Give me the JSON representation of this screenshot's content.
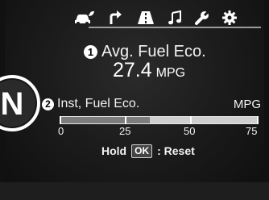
{
  "tabs": [
    {
      "name": "car-eco-tab",
      "icon": "car-leaf-icon",
      "active": true
    },
    {
      "name": "navigation-tab",
      "icon": "turn-arrow-icon"
    },
    {
      "name": "road-tab",
      "icon": "road-icon"
    },
    {
      "name": "music-tab",
      "icon": "music-note-icon"
    },
    {
      "name": "service-tab",
      "icon": "wrench-icon"
    },
    {
      "name": "settings-tab",
      "icon": "gear-icon"
    }
  ],
  "avg": {
    "index": "1",
    "label": "Avg. Fuel Eco.",
    "value": "27.4",
    "unit": "MPG"
  },
  "gear": {
    "letter": "N"
  },
  "inst": {
    "index": "2",
    "label": "Inst, Fuel Eco.",
    "unit": "MPG",
    "value_fraction": 0.45,
    "scale": [
      "0",
      "25",
      "50",
      "75"
    ]
  },
  "reset": {
    "hold": "Hold",
    "button": "OK",
    "action": ": Reset"
  },
  "colors": {
    "background": "#1c1c1c",
    "text": "#ffffff",
    "bar_fill": "#7d7d7d",
    "bar_track": "#cfcfcf"
  }
}
